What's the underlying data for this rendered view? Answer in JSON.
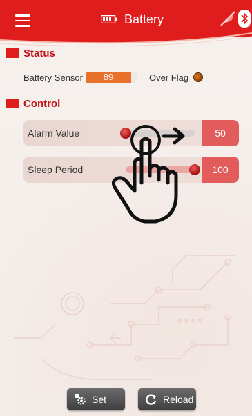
{
  "app_bar": {
    "title": "Battery",
    "title_icon": "battery-icon",
    "menu_icon": "hamburger-menu-icon",
    "status_icons": [
      "no-link-icon",
      "bluetooth-icon"
    ],
    "accent_color": "#e01d1d"
  },
  "status_section": {
    "heading": "Status",
    "battery_sensor_label": "Battery Sensor",
    "battery_sensor_value": "89",
    "battery_sensor_fill_color": "#e8722c",
    "over_flag_label": "Over Flag",
    "over_flag_color": "#8a3d00"
  },
  "control_section": {
    "heading": "Control",
    "alarm_value_label": "Alarm Value",
    "alarm_value": "50",
    "alarm_slider_level": 0.0,
    "sleep_period_label": "Sleep Period",
    "sleep_period_value": "100",
    "sleep_slider_level": 1.0,
    "gesture_icon": "swipe-right-hand-icon"
  },
  "buttons": {
    "set_label": "Set",
    "set_icon": "gear-icon",
    "reload_label": "Reload",
    "reload_icon": "refresh-icon"
  }
}
